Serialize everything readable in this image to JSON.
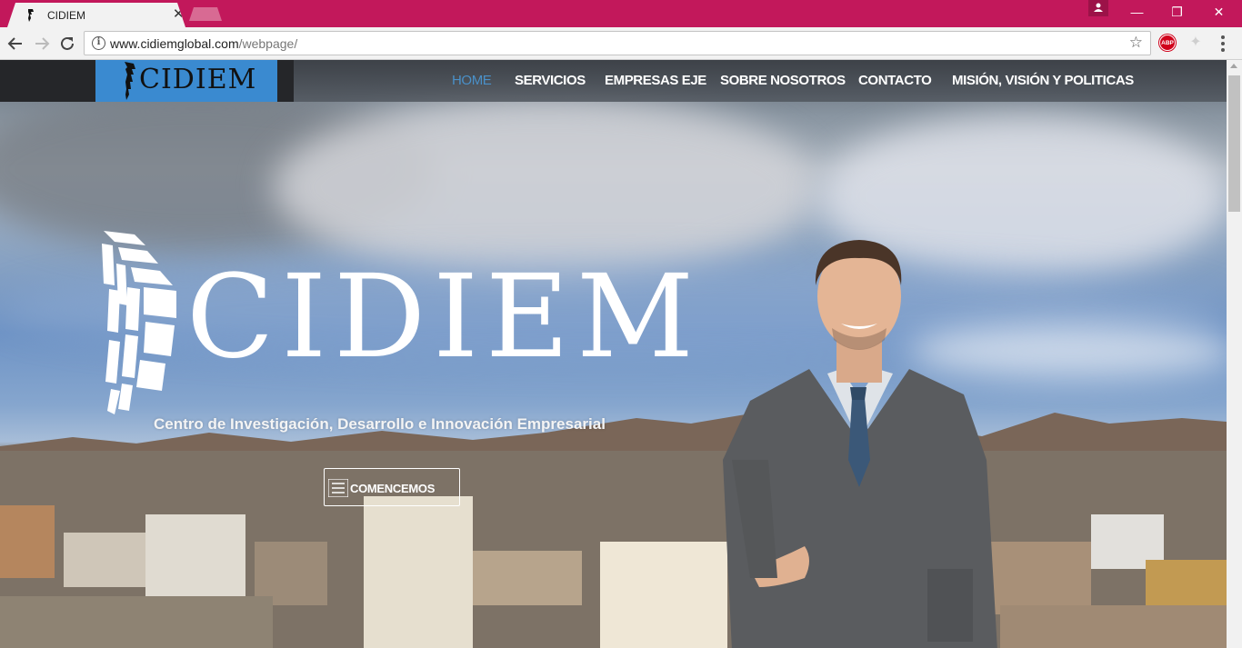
{
  "browser": {
    "tab_title": "CIDIEM",
    "tab_close": "✕",
    "url_host": "www.cidiemglobal.com",
    "url_path": "/webpage/",
    "extension_abp": "ABP",
    "accent_color": "#c2185b",
    "window_controls": {
      "minimize": "—",
      "maximize": "❐",
      "close": "✕"
    }
  },
  "site": {
    "logo_text": "CIDIEM",
    "nav": [
      {
        "label": "HOME",
        "active": true
      },
      {
        "label": "SERVICIOS",
        "active": false
      },
      {
        "label": "EMPRESAS EJE",
        "active": false
      },
      {
        "label": "SOBRE NOSOTROS",
        "active": false
      },
      {
        "label": "CONTACTO",
        "active": false
      },
      {
        "label": "MISIÓN, VISIÓN Y POLITICAS",
        "active": false
      }
    ],
    "hero": {
      "title": "CIDIEM",
      "subtitle": "Centro de Investigación, Desarrollo e Innovación Empresarial",
      "cta_label": "COMENCEMOS"
    },
    "brand_color": "#3a8ad0",
    "active_nav_color": "#4a90c8"
  }
}
